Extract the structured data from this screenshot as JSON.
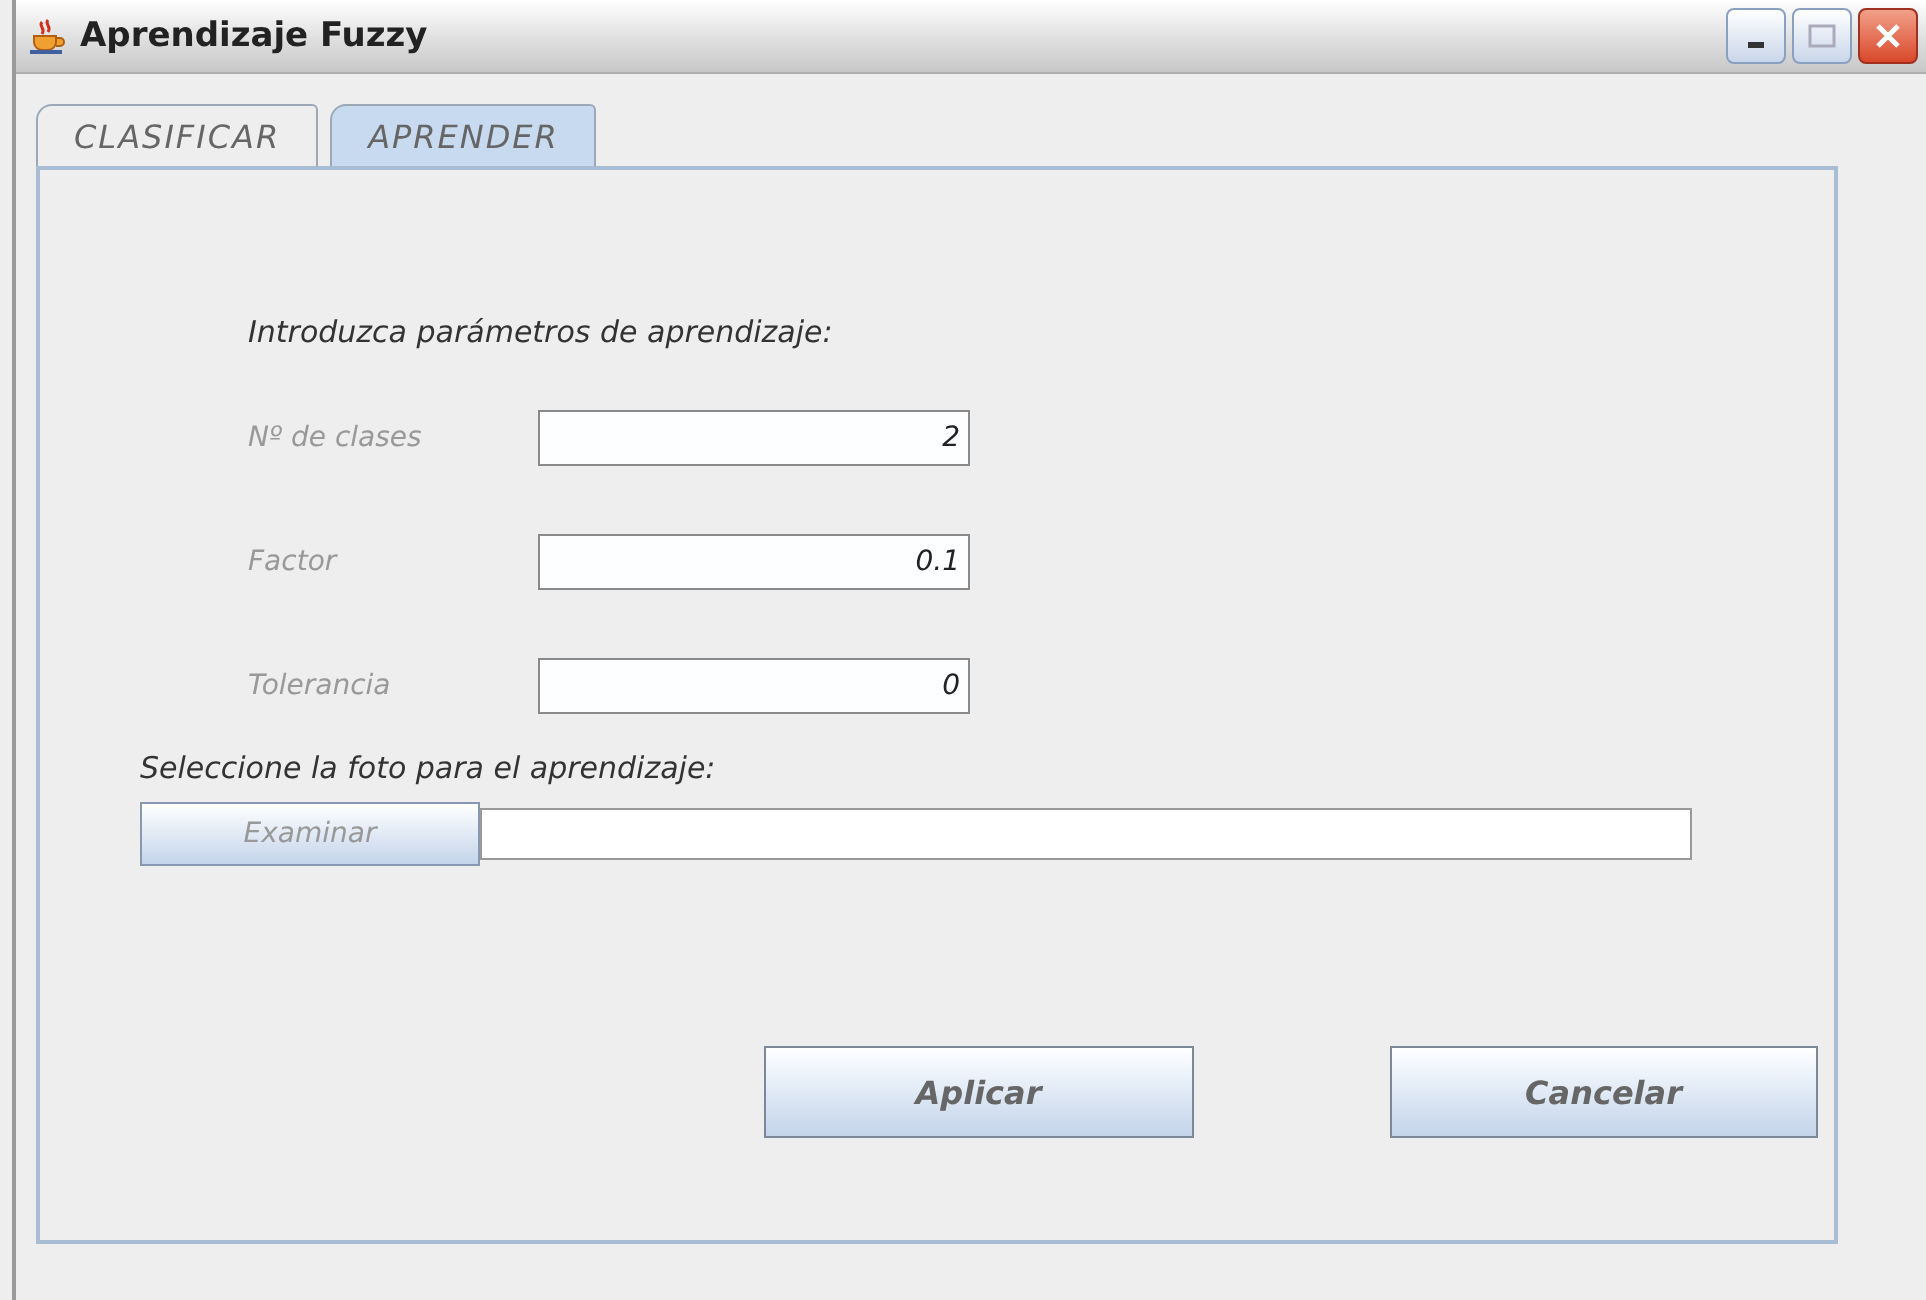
{
  "window": {
    "title": "Aprendizaje Fuzzy"
  },
  "tabs": [
    {
      "label": "CLASIFICAR",
      "selected": false
    },
    {
      "label": "APRENDER",
      "selected": true
    }
  ],
  "heading": "Introduzca parámetros de aprendizaje:",
  "params": [
    {
      "label": "Nº de clases",
      "value": "2"
    },
    {
      "label": "Factor",
      "value": "0.1"
    },
    {
      "label": "Tolerancia",
      "value": "0"
    }
  ],
  "photo": {
    "label": "Seleccione la foto para el aprendizaje:",
    "browse": "Examinar"
  },
  "buttons": [
    "Aplicar",
    "Cancelar"
  ]
}
